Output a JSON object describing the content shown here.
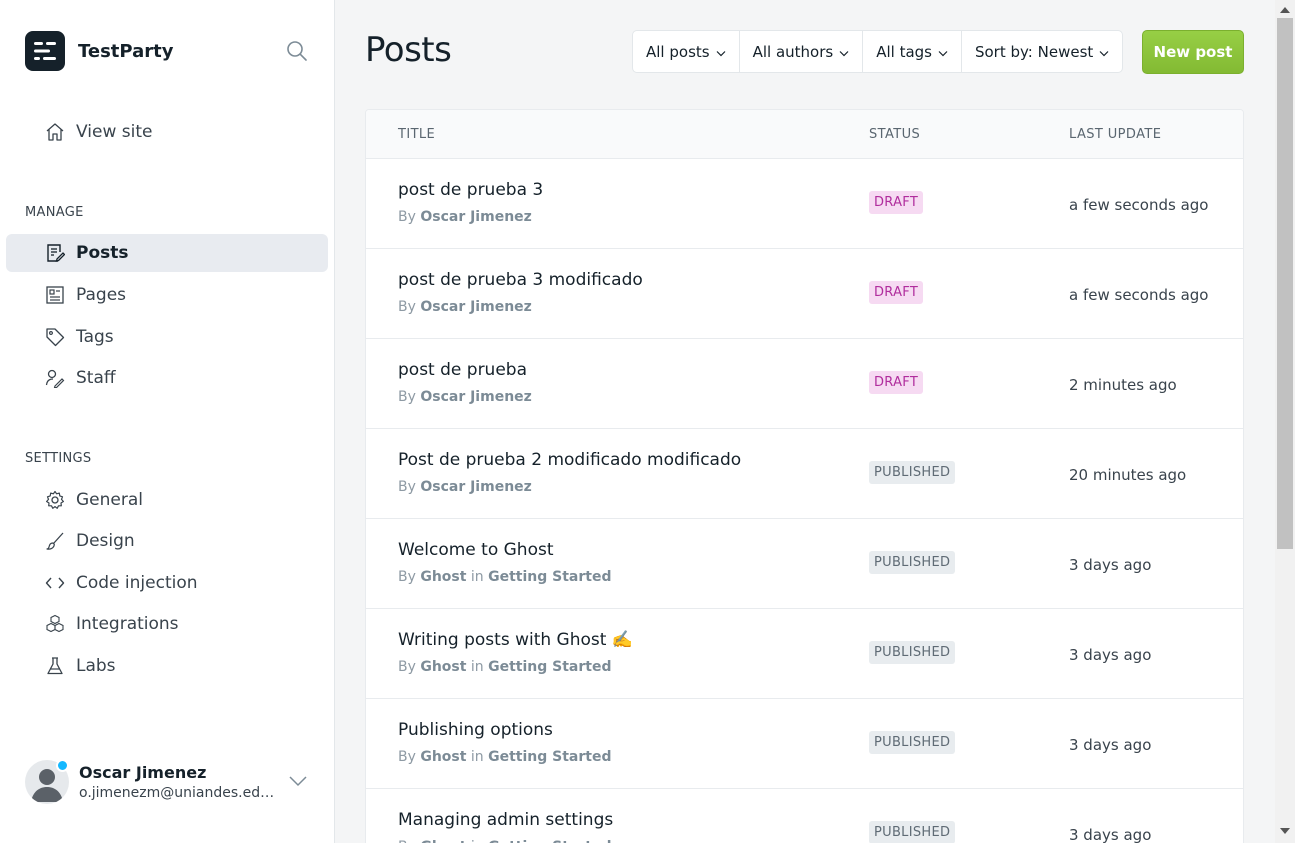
{
  "brand": {
    "name": "TestParty"
  },
  "sidebar": {
    "view_site": "View site",
    "manage_heading": "MANAGE",
    "manage_items": [
      {
        "label": "Posts",
        "icon": "posts-icon",
        "active": true
      },
      {
        "label": "Pages",
        "icon": "pages-icon",
        "active": false
      },
      {
        "label": "Tags",
        "icon": "tag-icon",
        "active": false
      },
      {
        "label": "Staff",
        "icon": "staff-icon",
        "active": false
      }
    ],
    "settings_heading": "SETTINGS",
    "settings_items": [
      {
        "label": "General",
        "icon": "gear-icon"
      },
      {
        "label": "Design",
        "icon": "brush-icon"
      },
      {
        "label": "Code injection",
        "icon": "code-icon"
      },
      {
        "label": "Integrations",
        "icon": "integrations-icon"
      },
      {
        "label": "Labs",
        "icon": "flask-icon"
      }
    ],
    "user": {
      "name": "Oscar Jimenez",
      "email": "o.jimenezm@uniandes.edu.co"
    }
  },
  "header": {
    "title": "Posts",
    "filters": [
      "All posts",
      "All authors",
      "All tags",
      "Sort by: Newest"
    ],
    "new_post": "New post"
  },
  "table": {
    "columns": [
      "TITLE",
      "STATUS",
      "LAST UPDATE"
    ],
    "by_label": "By",
    "in_label": "in",
    "rows": [
      {
        "title": "post de prueba 3",
        "author": "Oscar Jimenez",
        "tag": "",
        "status": "DRAFT",
        "updated": "a few seconds ago"
      },
      {
        "title": "post de prueba 3 modificado",
        "author": "Oscar Jimenez",
        "tag": "",
        "status": "DRAFT",
        "updated": "a few seconds ago"
      },
      {
        "title": "post de prueba",
        "author": "Oscar Jimenez",
        "tag": "",
        "status": "DRAFT",
        "updated": "2 minutes ago"
      },
      {
        "title": "Post de prueba 2 modificado modificado",
        "author": "Oscar Jimenez",
        "tag": "",
        "status": "PUBLISHED",
        "updated": "20 minutes ago"
      },
      {
        "title": "Welcome to Ghost",
        "author": "Ghost",
        "tag": "Getting Started",
        "status": "PUBLISHED",
        "updated": "3 days ago"
      },
      {
        "title": "Writing posts with Ghost ✍️",
        "author": "Ghost",
        "tag": "Getting Started",
        "status": "PUBLISHED",
        "updated": "3 days ago"
      },
      {
        "title": "Publishing options",
        "author": "Ghost",
        "tag": "Getting Started",
        "status": "PUBLISHED",
        "updated": "3 days ago"
      },
      {
        "title": "Managing admin settings",
        "author": "Ghost",
        "tag": "Getting Started",
        "status": "PUBLISHED",
        "updated": "3 days ago"
      }
    ]
  },
  "colors": {
    "accent": "#8dc63f",
    "draft": "#b02d9d",
    "published": "#5f6b75"
  }
}
